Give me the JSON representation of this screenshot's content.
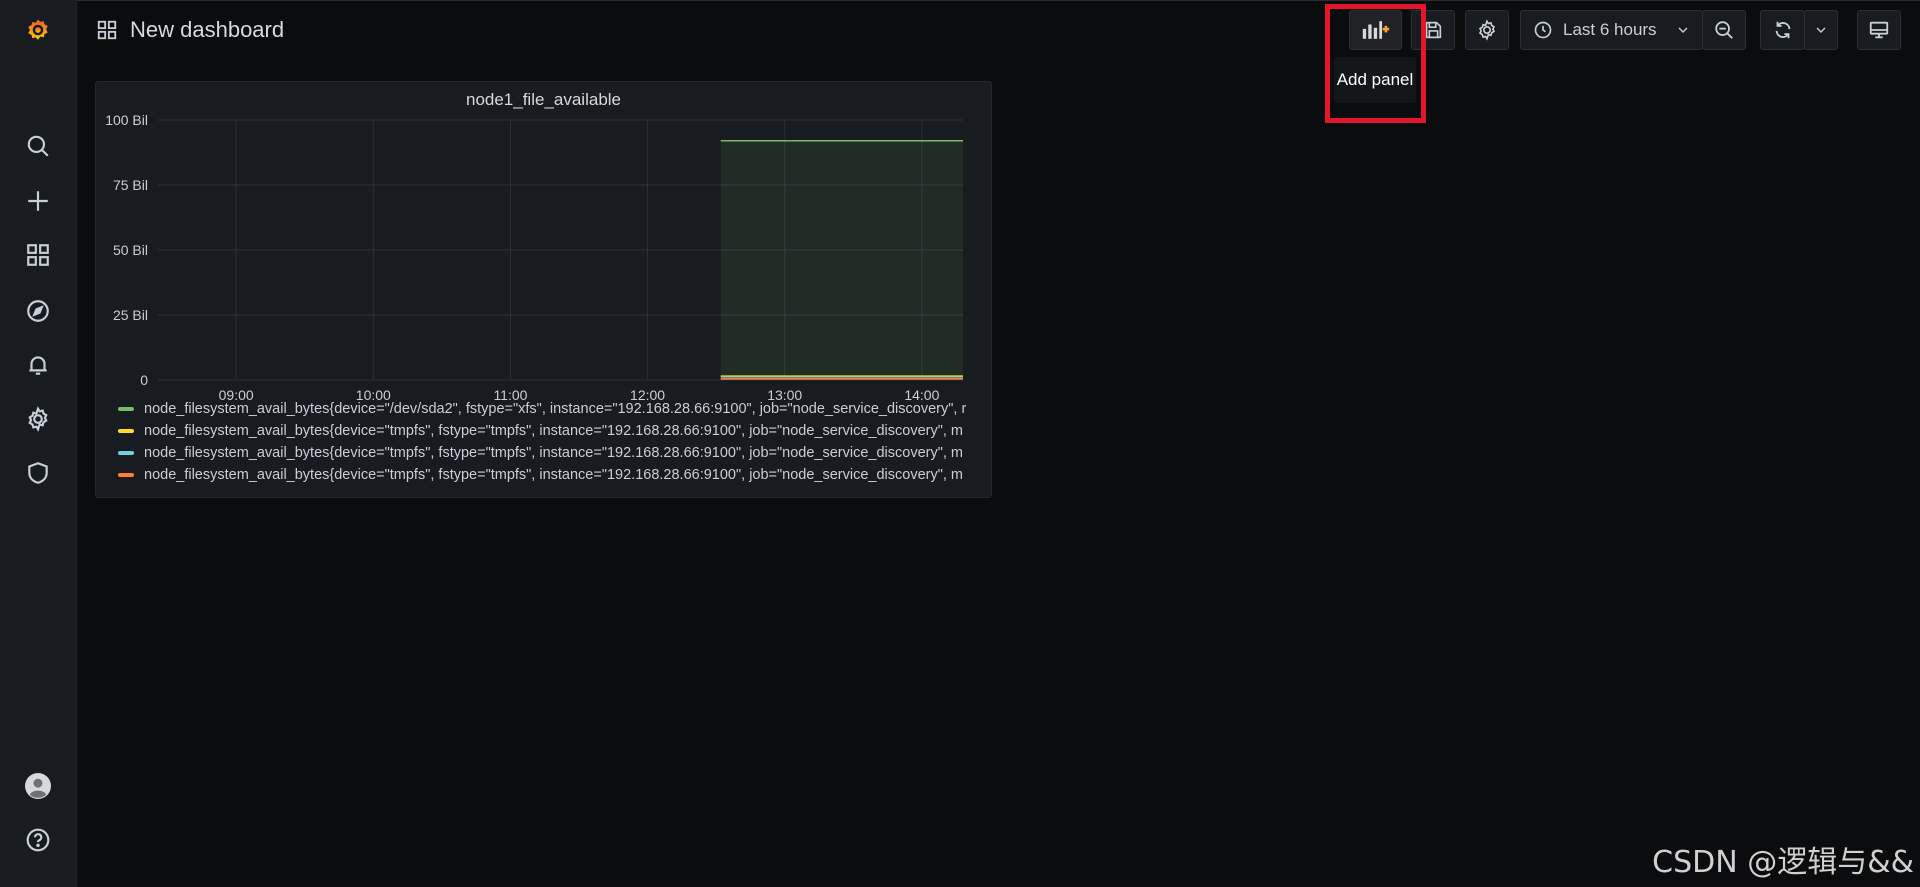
{
  "header": {
    "dashboard_title": "New dashboard",
    "time_range_label": "Last 6 hours",
    "tooltip_add_panel": "Add panel"
  },
  "panel": {
    "title": "node1_file_available"
  },
  "chart_data": {
    "type": "line",
    "title": "node1_file_available",
    "xlabel": "",
    "ylabel": "",
    "x_ticks": [
      "09:00",
      "10:00",
      "11:00",
      "12:00",
      "13:00",
      "14:00"
    ],
    "y_ticks": [
      "100 Bil",
      "75 Bil",
      "50 Bil",
      "25 Bil",
      "0"
    ],
    "ylim": [
      0,
      100
    ],
    "y_unit": "Bil",
    "grid": true,
    "legend_placement": "bottom",
    "series": [
      {
        "name": "node_filesystem_avail_bytes{device=\"/dev/sda2\", fstype=\"xfs\", instance=\"192.168.28.66:9100\", job=\"node_service_discovery\", r",
        "color": "#73bf69",
        "x_start": "12:32",
        "x_end": "14:18",
        "value": 92
      },
      {
        "name": "node_filesystem_avail_bytes{device=\"tmpfs\", fstype=\"tmpfs\", instance=\"192.168.28.66:9100\", job=\"node_service_discovery\", m",
        "color": "#fade2a",
        "x_start": "12:32",
        "x_end": "14:18",
        "value": 1.5
      },
      {
        "name": "node_filesystem_avail_bytes{device=\"tmpfs\", fstype=\"tmpfs\", instance=\"192.168.28.66:9100\", job=\"node_service_discovery\", m",
        "color": "#5794f2",
        "x_start": "12:32",
        "x_end": "14:18",
        "value": 0.8
      },
      {
        "name": "node_filesystem_avail_bytes{device=\"tmpfs\", fstype=\"tmpfs\", instance=\"192.168.28.66:9100\", job=\"node_service_discovery\", m",
        "color": "#ff7f2a",
        "x_start": "12:32",
        "x_end": "14:18",
        "value": 0.4
      }
    ]
  },
  "legend_colors": [
    "#73bf69",
    "#fade2a",
    "#6ed0e0",
    "#ff7f2a"
  ],
  "watermark": "CSDN @逻辑与&&",
  "icons": {
    "sidebar": [
      "grafana-logo-icon",
      "search-icon",
      "plus-icon",
      "dashboards-icon",
      "explore-icon",
      "alerting-bell-icon",
      "gear-icon",
      "shield-icon",
      "user-avatar-icon",
      "help-icon"
    ],
    "toolbar": [
      "add-panel-icon",
      "save-icon",
      "gear-icon",
      "clock-icon",
      "chevron-down-icon",
      "zoom-out-icon",
      "refresh-icon",
      "chevron-down-icon",
      "tv-mode-icon"
    ]
  }
}
